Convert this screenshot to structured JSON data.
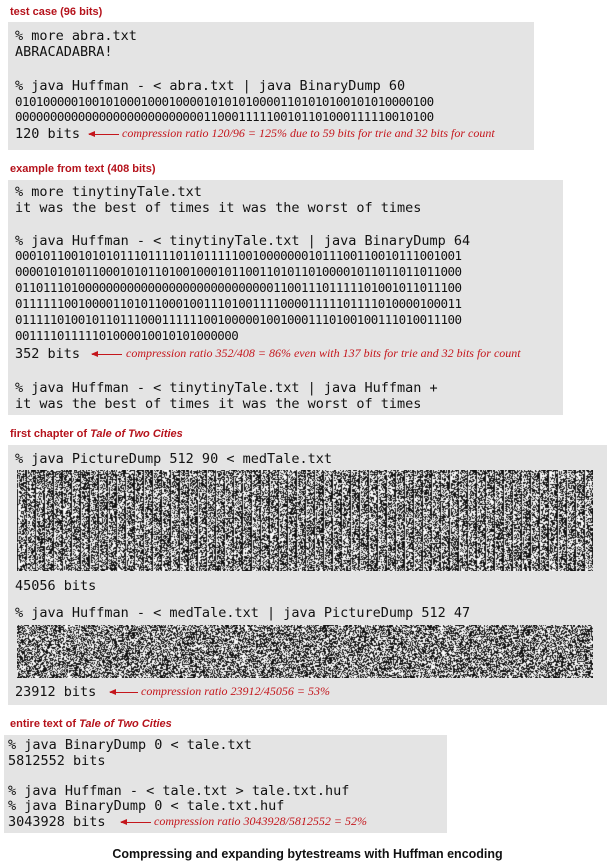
{
  "sections": {
    "test_case": {
      "header": "test case (96 bits)",
      "cmd1": "% more abra.txt",
      "out1": "ABRACADABRA!",
      "cmd2": "% java Huffman - < abra.txt | java BinaryDump 60",
      "bits": [
        "010100000100101000100010000101010100001101010100101010000100",
        "000000000000000000000000000110001111100101101000111110010100"
      ],
      "count": "120 bits",
      "note": "compression ratio 120/96 = 125% due to 59 bits for trie and 32 bits for count"
    },
    "example": {
      "header": "example from text (408 bits)",
      "cmd1": "% more tinytinyTale.txt",
      "out1": "it was the best of times it was the worst of times",
      "cmd2": "% java Huffman - < tinytinyTale.txt | java BinaryDump 64",
      "bits": [
        "0001011001010101110111101101111100100000001011100110010111001001",
        "0000101010110001010110100100010110011010110100001011011011011000",
        "0110111010000000000000000000000000000110011101111101001011011100",
        "0111111001000011010110001001110100111100001111101111010000100011",
        "0111110100101101110001111110010000010010001110100100111010011100",
        "00111101111101000010010101000000"
      ],
      "count": "352 bits",
      "note": "compression ratio 352/408 = 86% even with 137 bits for trie and 32 bits for count",
      "cmd3": "% java Huffman - < tinytinyTale.txt | java Huffman +",
      "out3": "it was the best of times it was the worst of times"
    },
    "first_chapter": {
      "header_prefix": "first chapter of ",
      "header_title": "Tale of Two Cities",
      "cmd1": "% java PictureDump 512 90 < medTale.txt",
      "count1": "45056 bits",
      "cmd2": "% java Huffman - < medTale.txt | java PictureDump 512 47",
      "count2": "23912 bits",
      "note": "compression ratio 23912/45056 = 53%"
    },
    "entire_text": {
      "header_prefix": "entire text of ",
      "header_title": "Tale of Two Cities",
      "cmd1": "% java BinaryDump 0 < tale.txt",
      "out1": "5812552 bits",
      "cmd2": "% java Huffman - < tale.txt > tale.txt.huf",
      "cmd3": "% java BinaryDump 0 < tale.txt.huf",
      "out3": "3043928 bits",
      "note": "compression ratio 3043928/5812552 = 52%"
    }
  },
  "caption": "Compressing and expanding bytestreams with Huffman encoding",
  "colors": {
    "accent": "#c4161c",
    "panel": "#e4e4e4"
  }
}
